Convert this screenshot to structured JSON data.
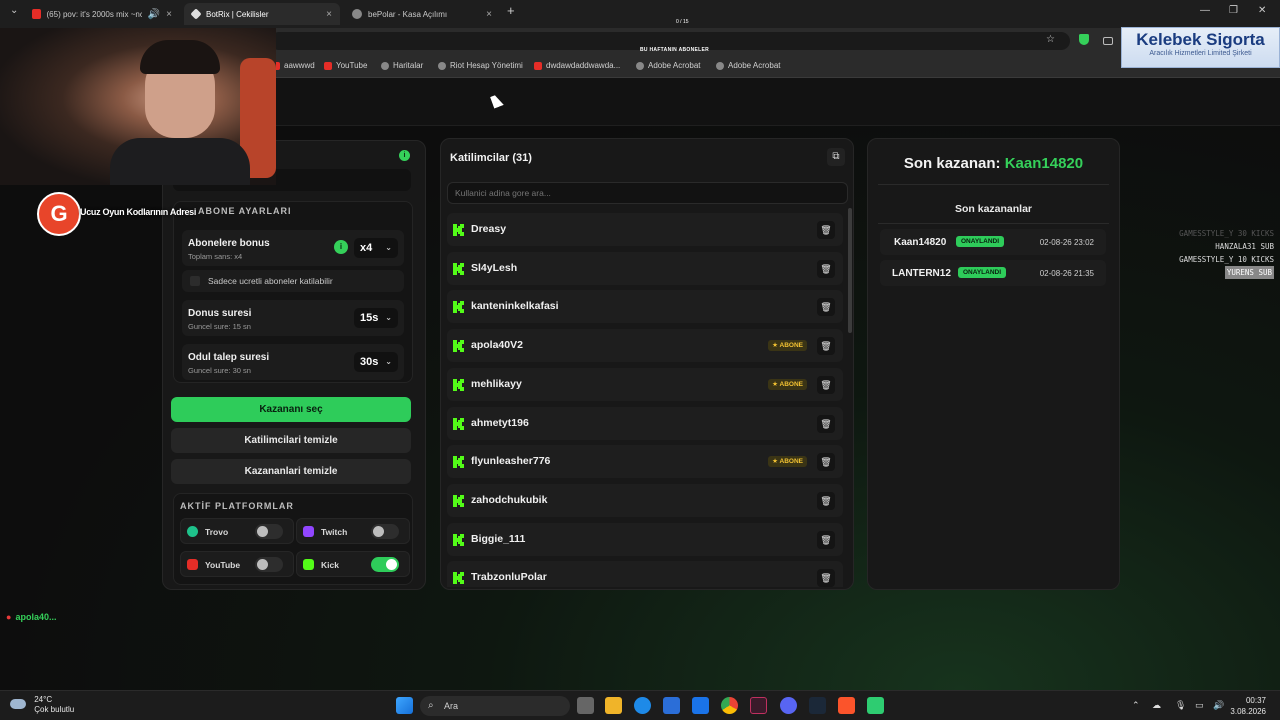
{
  "browser": {
    "tabs": [
      {
        "title": "(65) pov: it's 2000s mix ~nc",
        "active": false,
        "fav_color": "#e52d27"
      },
      {
        "title": "BotRix | Cekilisler",
        "active": true,
        "fav_color": "#dddddd"
      },
      {
        "title": "bePolar - Kasa Açılımı",
        "active": false,
        "fav_color": "#888888"
      }
    ],
    "new_tab": "+",
    "bookmarks": [
      {
        "label": "aawwwd",
        "type": "yt"
      },
      {
        "label": "YouTube",
        "type": "yt"
      },
      {
        "label": "Haritalar",
        "type": "globe"
      },
      {
        "label": "Riot Hesap Yönetimi",
        "type": "globe"
      },
      {
        "label": "dwdawdaddwawda...",
        "type": "yt"
      },
      {
        "label": "Adobe Acrobat",
        "type": "globe"
      },
      {
        "label": "Adobe Acrobat",
        "type": "globe"
      }
    ]
  },
  "stream": {
    "counter": "0 / 15",
    "subs_banner": "BU HAFTANIN ABONELER",
    "sponsor_title": "Kelebek Sigorta",
    "sponsor_sub": "Aracılık Hizmetleri Limited Şirketi",
    "promo": "Ucuz Oyun Kodlarının Adresi",
    "promo_logo": "G",
    "feed": [
      {
        "text": "GAMESSTYLE_Y 30 KICKS",
        "style": "faded"
      },
      {
        "text": "HANZALA31 SUB",
        "style": ""
      },
      {
        "text": "GAMESSTYLE_Y 10 KICKS",
        "style": ""
      },
      {
        "text": "YURENS SUB",
        "style": "hl"
      }
    ],
    "chatter": "apola40..."
  },
  "settings": {
    "section_title": "ABONE AYARLARI",
    "sub_bonus": {
      "label": "Abonelere bonus",
      "sub": "Toplam sans: x4",
      "value": "x4"
    },
    "only_paid": "Sadece ucretli aboneler katilabilir",
    "bonus_duration": {
      "label": "Donus suresi",
      "sub": "Guncel sure: 15 sn",
      "value": "15s"
    },
    "claim_duration": {
      "label": "Odul talep suresi",
      "sub": "Guncel sure: 30 sn",
      "value": "30s"
    },
    "buttons": {
      "pick_winner": "Kazananı seç",
      "clear_participants": "Katilimcilari temizle",
      "clear_winners": "Kazananlari temizle"
    },
    "platforms_title": "AKTİF PLATFORMLAR",
    "platforms": [
      {
        "name": "Trovo",
        "on": false,
        "color": "#1ec28b"
      },
      {
        "name": "Twitch",
        "on": false,
        "color": "#9146ff"
      },
      {
        "name": "YouTube",
        "on": false,
        "color": "#e52d27"
      },
      {
        "name": "Kick",
        "on": true,
        "color": "#53fc18"
      }
    ]
  },
  "participants": {
    "title": "Katilimcilar (31)",
    "search_placeholder": "Kullanici adina gore ara...",
    "badge_label": "ABONE",
    "items": [
      {
        "name": "Dreasy",
        "abone": false
      },
      {
        "name": "Sl4yLesh",
        "abone": false
      },
      {
        "name": "kanteninkelkafasi",
        "abone": false
      },
      {
        "name": "apola40V2",
        "abone": true
      },
      {
        "name": "mehlikayy",
        "abone": true
      },
      {
        "name": "ahmetyt196",
        "abone": false
      },
      {
        "name": "flyunleasher776",
        "abone": true
      },
      {
        "name": "zahodchukubik",
        "abone": false
      },
      {
        "name": "Biggie_111",
        "abone": false
      },
      {
        "name": "TrabzonluPolar",
        "abone": false
      }
    ]
  },
  "winners": {
    "last_label": "Son kazanan:",
    "last_name": "Kaan14820",
    "title": "Son kazananlar",
    "items": [
      {
        "name": "Kaan14820",
        "status": "ONAYLANDI",
        "date": "02-08-26 23:02"
      },
      {
        "name": "LANTERN12",
        "status": "ONAYLANDI",
        "date": "02-08-26 21:35"
      }
    ]
  },
  "taskbar": {
    "temp": "24°C",
    "weather": "Çok bulutlu",
    "search": "Ara",
    "time": "00:37",
    "date": "3.08.2026"
  }
}
